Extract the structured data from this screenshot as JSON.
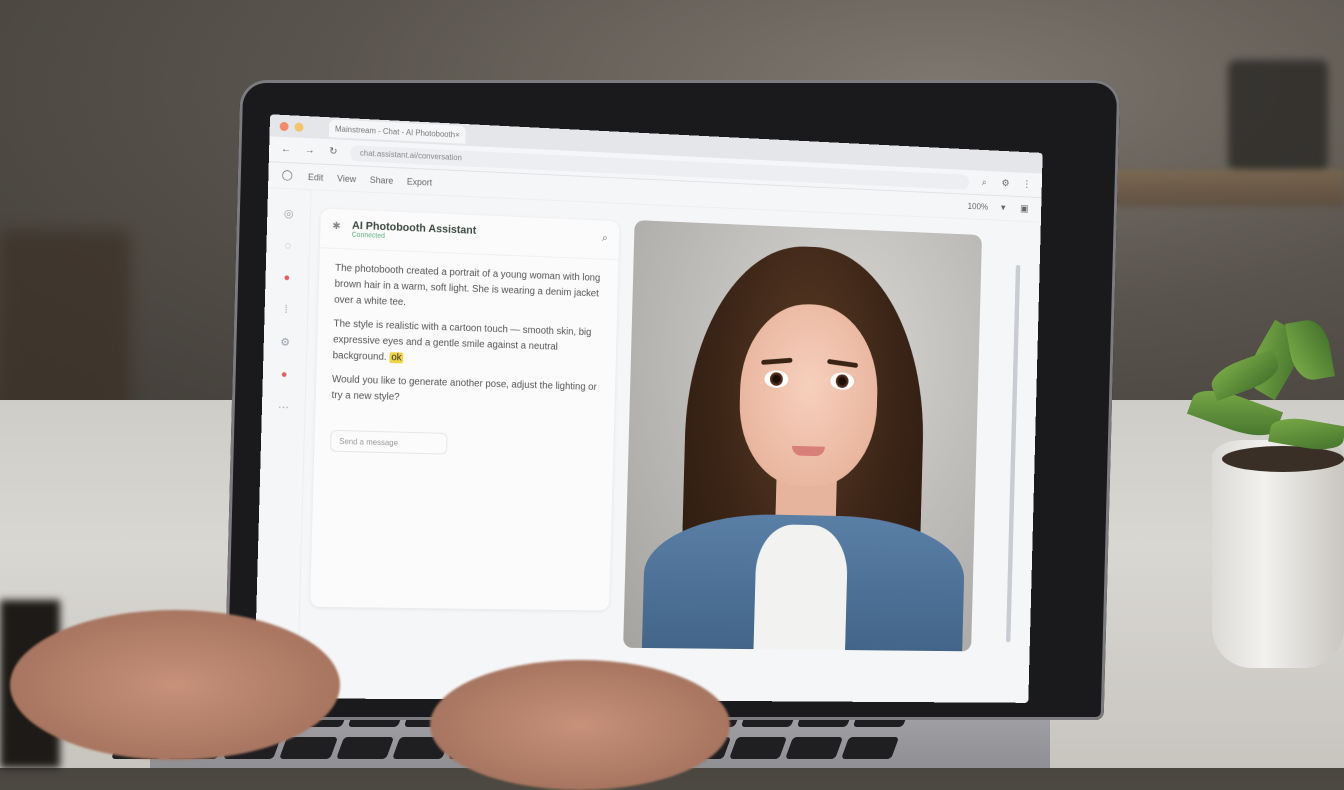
{
  "browser": {
    "tab_label": "Mainstream - Chat - AI Photobooth",
    "url": "chat.assistant.ai/conversation",
    "toolbar_items": [
      "Edit",
      "View",
      "Share",
      "Export"
    ],
    "toolbar_right": "100%"
  },
  "chat": {
    "title": "AI Photobooth Assistant",
    "subtitle": "Connected",
    "paragraphs": [
      "The photobooth created a portrait of a young woman with long brown hair in a warm, soft light. She is wearing a denim jacket over a white tee.",
      "The style is realistic with a cartoon touch — smooth skin, big expressive eyes and a gentle smile against a neutral background.",
      "Would you like to generate another pose, adjust the lighting or try a new style?"
    ],
    "highlight": "ok",
    "input_placeholder": "Send a message"
  },
  "icons": {
    "search": "search-icon",
    "close": "close-icon",
    "menu": "menu-icon"
  },
  "colors": {
    "accent_green": "#5fae7a",
    "highlight": "#f2d44a",
    "denim": "#4a6f96"
  }
}
